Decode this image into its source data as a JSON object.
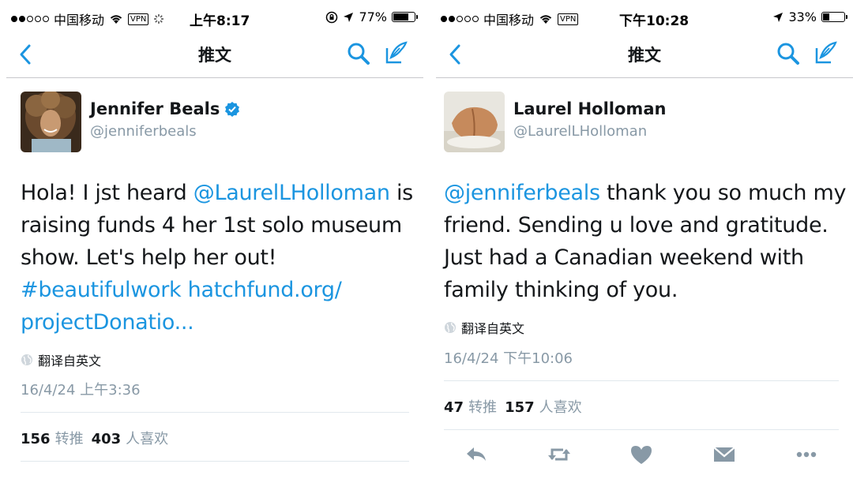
{
  "screens": [
    {
      "status": {
        "carrier": "中国移动",
        "vpn": "VPN",
        "time": "上午8:17",
        "battery": "77%"
      },
      "nav": {
        "title": "推文"
      },
      "author": {
        "name": "Jennifer Beals",
        "handle": "@jenniferbeals",
        "verified": true
      },
      "tweet": {
        "line1_pre": "Hola! I jst heard ",
        "line1_mention": "@LaurelLHolloman",
        "line1_post": " is",
        "line2": "raising funds 4 her 1st solo museum",
        "line3": "show. Let's help her out!",
        "line4_hashtag": "#beautifulwork",
        "line4_link": " hatchfund.org/",
        "line5_link": "projectDonatio..."
      },
      "translate": "翻译自英文",
      "timestamp": "16/4/24 上午3:36",
      "stats": {
        "retweets": "156",
        "retweets_label": "转推",
        "likes": "403",
        "likes_label": "人喜欢"
      }
    },
    {
      "status": {
        "carrier": "中国移动",
        "vpn": "VPN",
        "time": "下午10:28",
        "battery": "33%"
      },
      "nav": {
        "title": "推文"
      },
      "author": {
        "name": "Laurel Holloman",
        "handle": "@LaurelLHolloman",
        "verified": false
      },
      "tweet": {
        "line1_mention": "@jenniferbeals",
        "line1_post": " thank you so much my",
        "line2": "friend.  Sending u love and gratitude.",
        "line3": "Just had a Canadian weekend with",
        "line4": "family thinking of you."
      },
      "translate": "翻译自英文",
      "timestamp": "16/4/24 下午10:06",
      "stats": {
        "retweets": "47",
        "retweets_label": "转推",
        "likes": "157",
        "likes_label": "人喜欢"
      }
    }
  ],
  "colors": {
    "accent": "#1b95e0",
    "muted": "#8899a6",
    "text": "#14171a",
    "divider": "#e1e8ed"
  }
}
